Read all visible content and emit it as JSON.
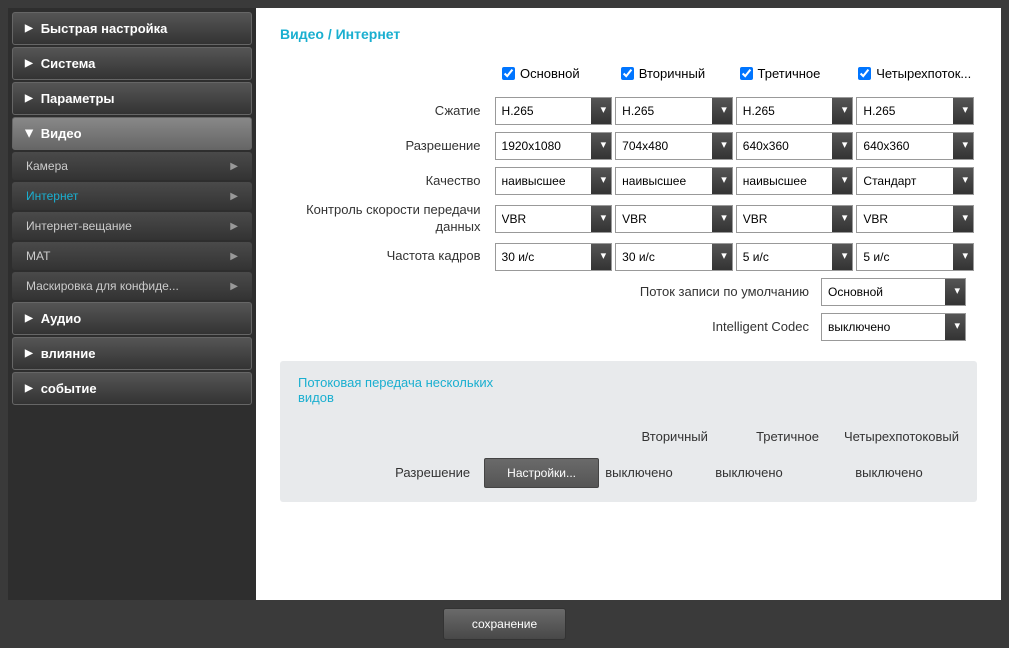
{
  "sidebar": {
    "items": [
      {
        "label": "Быстрая настройка"
      },
      {
        "label": "Система"
      },
      {
        "label": "Параметры"
      },
      {
        "label": "Видео",
        "expanded": true,
        "children": [
          {
            "label": "Камера"
          },
          {
            "label": "Интернет",
            "active": true
          },
          {
            "label": "Интернет-вещание"
          },
          {
            "label": "MAT"
          },
          {
            "label": "Маскировка для конфиде..."
          }
        ]
      },
      {
        "label": "Аудио"
      },
      {
        "label": "влияние"
      },
      {
        "label": "событие"
      }
    ]
  },
  "page": {
    "title": "Видео / Интернет"
  },
  "streams": [
    {
      "name": "Основной",
      "checked": true
    },
    {
      "name": "Вторичный",
      "checked": true
    },
    {
      "name": "Третичное",
      "checked": true
    },
    {
      "name": "Четырехпоток...",
      "checked": true
    }
  ],
  "rows": {
    "compression": {
      "label": "Сжатие",
      "values": [
        "H.265",
        "H.265",
        "H.265",
        "H.265"
      ]
    },
    "resolution": {
      "label": "Разрешение",
      "values": [
        "1920x1080",
        "704x480",
        "640x360",
        "640x360"
      ]
    },
    "quality": {
      "label": "Качество",
      "values": [
        "наивысшее",
        "наивысшее",
        "наивысшее",
        "Стандарт"
      ]
    },
    "bitrate_control": {
      "label": "Контроль скорости передачи данных",
      "values": [
        "VBR",
        "VBR",
        "VBR",
        "VBR"
      ]
    },
    "framerate": {
      "label": "Частота кадров",
      "values": [
        "30 и/с",
        "30 и/с",
        "5 и/с",
        "5 и/с"
      ]
    }
  },
  "extras": {
    "default_record": {
      "label": "Поток записи по умолчанию",
      "value": "Основной"
    },
    "intelligent_codec": {
      "label": "Intelligent Codec",
      "value": "выключено"
    }
  },
  "secondary": {
    "title": "Потоковая передача нескольких видов",
    "row_label": "Разрешение",
    "button": "Настройки...",
    "headers": [
      "Вторичный",
      "Третичное",
      "Четырехпотоковый"
    ],
    "values": [
      "выключено",
      "выключено",
      "выключено"
    ]
  },
  "footer": {
    "save": "сохранение"
  }
}
